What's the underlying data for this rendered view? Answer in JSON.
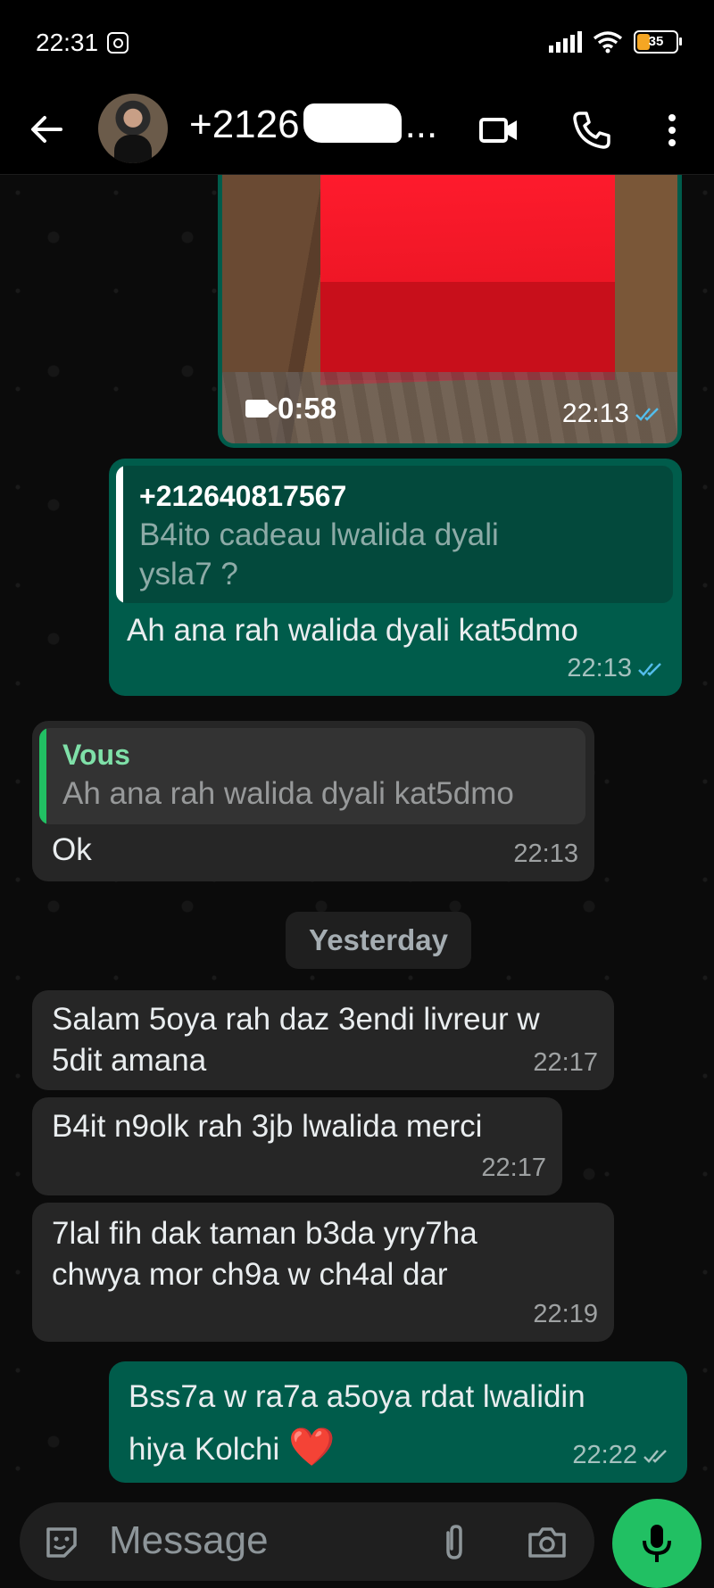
{
  "status": {
    "time": "22:31",
    "battery": "35"
  },
  "header": {
    "contact": "+2126",
    "contact_suffix": "..."
  },
  "video_message": {
    "duration": "0:58",
    "time": "22:13"
  },
  "messages": [
    {
      "quote_author": "+212640817567",
      "quote_text": "B4ito cadeau lwalida dyali ysla7 ?",
      "text": "Ah ana rah walida dyali kat5dmo",
      "time": "22:13"
    },
    {
      "quote_author": "Vous",
      "quote_text": "Ah ana rah walida dyali kat5dmo",
      "text": "Ok",
      "time": "22:13"
    },
    {
      "text": "Salam 5oya rah daz 3endi livreur w 5dit amana",
      "time": "22:17"
    },
    {
      "text": "B4it n9olk rah 3jb lwalida merci",
      "time": "22:17"
    },
    {
      "text": "7lal fih dak taman b3da yry7ha chwya mor ch9a w ch4al dar",
      "time": "22:19"
    },
    {
      "text": "Bss7a w ra7a a5oya rdat lwalidin hiya Kolchi",
      "emoji": "❤️",
      "time": "22:22"
    }
  ],
  "day_chip": "Yesterday",
  "composer": {
    "placeholder": "Message"
  },
  "colors": {
    "outgoing": "#005c4b",
    "incoming": "#262626",
    "accent": "#21c063",
    "read_ticks": "#53bdeb"
  }
}
